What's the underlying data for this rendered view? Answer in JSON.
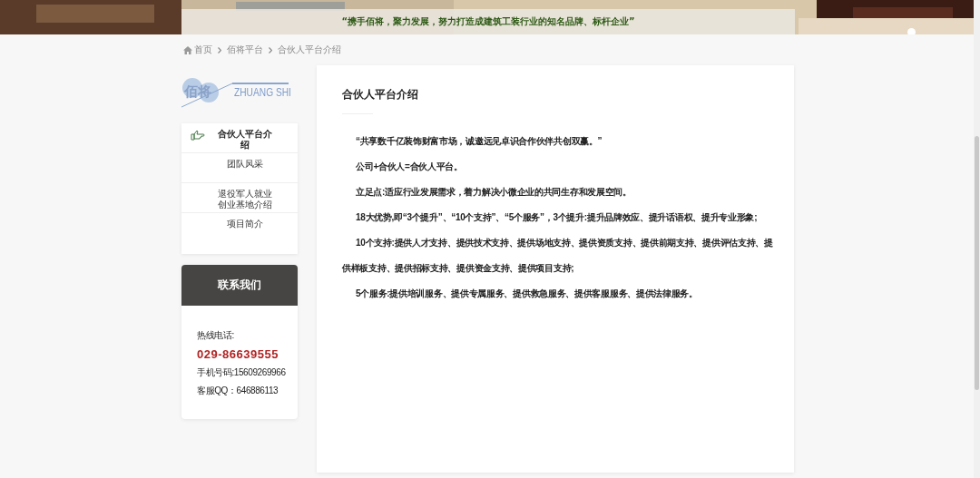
{
  "banner": {
    "slogan": "“携手佰将，聚力发展，努力打造成建筑工装行业的知名品牌、标杆企业”"
  },
  "breadcrumb": [
    {
      "label": "首页",
      "kind": "home"
    },
    {
      "label": "佰将平台",
      "kind": "link"
    },
    {
      "label": "合伙人平台介绍",
      "kind": "current"
    }
  ],
  "logo": {
    "mark": "佰将",
    "text": "ZHUANG SHI"
  },
  "sidebar": {
    "items": [
      {
        "label": "合伙人平台介绍",
        "selected": true
      },
      {
        "label": "团队风采",
        "selected": false
      },
      {
        "label": "退役军人就业创业基地介绍",
        "selected": false
      },
      {
        "label": "项目简介",
        "selected": false
      }
    ]
  },
  "contact": {
    "title": "联系我们",
    "hotline_label": "热线电话:",
    "hotline": "029-86639555",
    "mobile": "手机号码:15609269966",
    "qq": "客服QQ：646886113"
  },
  "article": {
    "title": "合伙人平台介绍",
    "paragraphs": [
      "“共享数千亿装饰财富市场，诚邀远见卓识合作伙伴共创双赢。”",
      "公司+合伙人=合伙人平台。",
      "立足点:适应行业发展需求，着力解决小微企业的共同生存和发展空间。",
      "18大优势,即“3个提升”、“10个支持”、“5个服务”，3个提升:提升品牌效应、提升话语权、提升专业形象;",
      "10个支持:提供人才支持、提供技术支持、提供场地支持、提供资质支持、提供前期支持、提供评估支持、提供样板支持、提供招标支持、提供资金支持、提供项目支持;",
      "5个服务:提供培训服务、提供专属服务、提供救急服务、提供客服服务、提供法律服务。"
    ]
  }
}
